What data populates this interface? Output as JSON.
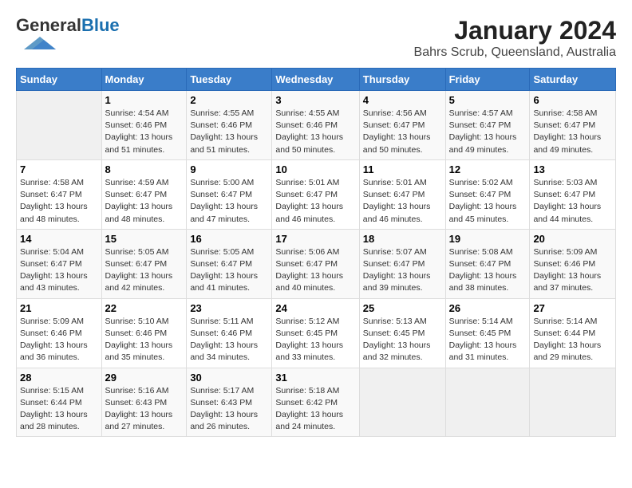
{
  "header": {
    "logo_general": "General",
    "logo_blue": "Blue",
    "title": "January 2024",
    "subtitle": "Bahrs Scrub, Queensland, Australia"
  },
  "days_of_week": [
    "Sunday",
    "Monday",
    "Tuesday",
    "Wednesday",
    "Thursday",
    "Friday",
    "Saturday"
  ],
  "weeks": [
    [
      {
        "day": "",
        "info": ""
      },
      {
        "day": "1",
        "info": "Sunrise: 4:54 AM\nSunset: 6:46 PM\nDaylight: 13 hours\nand 51 minutes."
      },
      {
        "day": "2",
        "info": "Sunrise: 4:55 AM\nSunset: 6:46 PM\nDaylight: 13 hours\nand 51 minutes."
      },
      {
        "day": "3",
        "info": "Sunrise: 4:55 AM\nSunset: 6:46 PM\nDaylight: 13 hours\nand 50 minutes."
      },
      {
        "day": "4",
        "info": "Sunrise: 4:56 AM\nSunset: 6:47 PM\nDaylight: 13 hours\nand 50 minutes."
      },
      {
        "day": "5",
        "info": "Sunrise: 4:57 AM\nSunset: 6:47 PM\nDaylight: 13 hours\nand 49 minutes."
      },
      {
        "day": "6",
        "info": "Sunrise: 4:58 AM\nSunset: 6:47 PM\nDaylight: 13 hours\nand 49 minutes."
      }
    ],
    [
      {
        "day": "7",
        "info": "Sunrise: 4:58 AM\nSunset: 6:47 PM\nDaylight: 13 hours\nand 48 minutes."
      },
      {
        "day": "8",
        "info": "Sunrise: 4:59 AM\nSunset: 6:47 PM\nDaylight: 13 hours\nand 48 minutes."
      },
      {
        "day": "9",
        "info": "Sunrise: 5:00 AM\nSunset: 6:47 PM\nDaylight: 13 hours\nand 47 minutes."
      },
      {
        "day": "10",
        "info": "Sunrise: 5:01 AM\nSunset: 6:47 PM\nDaylight: 13 hours\nand 46 minutes."
      },
      {
        "day": "11",
        "info": "Sunrise: 5:01 AM\nSunset: 6:47 PM\nDaylight: 13 hours\nand 46 minutes."
      },
      {
        "day": "12",
        "info": "Sunrise: 5:02 AM\nSunset: 6:47 PM\nDaylight: 13 hours\nand 45 minutes."
      },
      {
        "day": "13",
        "info": "Sunrise: 5:03 AM\nSunset: 6:47 PM\nDaylight: 13 hours\nand 44 minutes."
      }
    ],
    [
      {
        "day": "14",
        "info": "Sunrise: 5:04 AM\nSunset: 6:47 PM\nDaylight: 13 hours\nand 43 minutes."
      },
      {
        "day": "15",
        "info": "Sunrise: 5:05 AM\nSunset: 6:47 PM\nDaylight: 13 hours\nand 42 minutes."
      },
      {
        "day": "16",
        "info": "Sunrise: 5:05 AM\nSunset: 6:47 PM\nDaylight: 13 hours\nand 41 minutes."
      },
      {
        "day": "17",
        "info": "Sunrise: 5:06 AM\nSunset: 6:47 PM\nDaylight: 13 hours\nand 40 minutes."
      },
      {
        "day": "18",
        "info": "Sunrise: 5:07 AM\nSunset: 6:47 PM\nDaylight: 13 hours\nand 39 minutes."
      },
      {
        "day": "19",
        "info": "Sunrise: 5:08 AM\nSunset: 6:47 PM\nDaylight: 13 hours\nand 38 minutes."
      },
      {
        "day": "20",
        "info": "Sunrise: 5:09 AM\nSunset: 6:46 PM\nDaylight: 13 hours\nand 37 minutes."
      }
    ],
    [
      {
        "day": "21",
        "info": "Sunrise: 5:09 AM\nSunset: 6:46 PM\nDaylight: 13 hours\nand 36 minutes."
      },
      {
        "day": "22",
        "info": "Sunrise: 5:10 AM\nSunset: 6:46 PM\nDaylight: 13 hours\nand 35 minutes."
      },
      {
        "day": "23",
        "info": "Sunrise: 5:11 AM\nSunset: 6:46 PM\nDaylight: 13 hours\nand 34 minutes."
      },
      {
        "day": "24",
        "info": "Sunrise: 5:12 AM\nSunset: 6:45 PM\nDaylight: 13 hours\nand 33 minutes."
      },
      {
        "day": "25",
        "info": "Sunrise: 5:13 AM\nSunset: 6:45 PM\nDaylight: 13 hours\nand 32 minutes."
      },
      {
        "day": "26",
        "info": "Sunrise: 5:14 AM\nSunset: 6:45 PM\nDaylight: 13 hours\nand 31 minutes."
      },
      {
        "day": "27",
        "info": "Sunrise: 5:14 AM\nSunset: 6:44 PM\nDaylight: 13 hours\nand 29 minutes."
      }
    ],
    [
      {
        "day": "28",
        "info": "Sunrise: 5:15 AM\nSunset: 6:44 PM\nDaylight: 13 hours\nand 28 minutes."
      },
      {
        "day": "29",
        "info": "Sunrise: 5:16 AM\nSunset: 6:43 PM\nDaylight: 13 hours\nand 27 minutes."
      },
      {
        "day": "30",
        "info": "Sunrise: 5:17 AM\nSunset: 6:43 PM\nDaylight: 13 hours\nand 26 minutes."
      },
      {
        "day": "31",
        "info": "Sunrise: 5:18 AM\nSunset: 6:42 PM\nDaylight: 13 hours\nand 24 minutes."
      },
      {
        "day": "",
        "info": ""
      },
      {
        "day": "",
        "info": ""
      },
      {
        "day": "",
        "info": ""
      }
    ]
  ]
}
